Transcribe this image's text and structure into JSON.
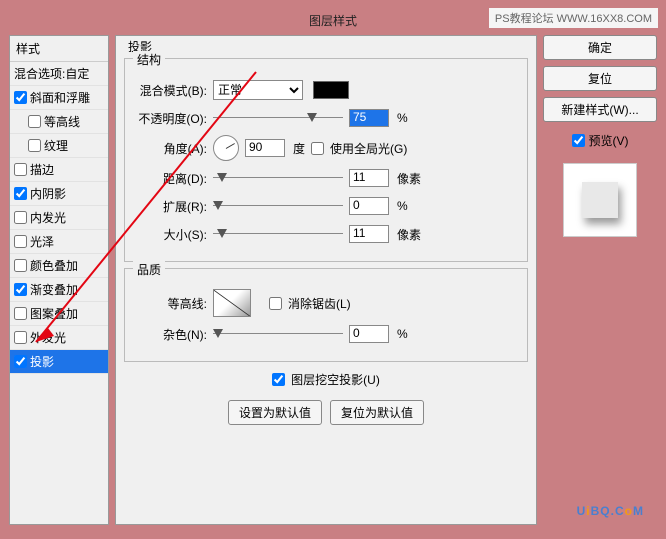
{
  "watermark_top": "PS教程论坛  WWW.16XX8.COM",
  "watermark_bot": [
    "U",
    "i",
    "B",
    "Q",
    ".",
    "C",
    "o",
    "M"
  ],
  "title": "图层样式",
  "sidebar": {
    "header": "样式",
    "blend": "混合选项:自定",
    "items": [
      {
        "label": "斜面和浮雕",
        "checked": true
      },
      {
        "label": "等高线",
        "checked": false,
        "sub": true
      },
      {
        "label": "纹理",
        "checked": false,
        "sub": true
      },
      {
        "label": "描边",
        "checked": false
      },
      {
        "label": "内阴影",
        "checked": true
      },
      {
        "label": "内发光",
        "checked": false
      },
      {
        "label": "光泽",
        "checked": false
      },
      {
        "label": "颜色叠加",
        "checked": false
      },
      {
        "label": "渐变叠加",
        "checked": true
      },
      {
        "label": "图案叠加",
        "checked": false
      },
      {
        "label": "外发光",
        "checked": false
      },
      {
        "label": "投影",
        "checked": true,
        "selected": true
      }
    ]
  },
  "panel": {
    "title": "投影",
    "structure": {
      "title": "结构",
      "blend_mode_label": "混合模式(B):",
      "blend_mode_value": "正常",
      "opacity_label": "不透明度(O):",
      "opacity_value": "75",
      "opacity_unit": "%",
      "angle_label": "角度(A):",
      "angle_value": "90",
      "angle_unit": "度",
      "global_light": "使用全局光(G)",
      "distance_label": "距离(D):",
      "distance_value": "11",
      "distance_unit": "像素",
      "spread_label": "扩展(R):",
      "spread_value": "0",
      "spread_unit": "%",
      "size_label": "大小(S):",
      "size_value": "11",
      "size_unit": "像素"
    },
    "quality": {
      "title": "品质",
      "contour_label": "等高线:",
      "antialias": "消除锯齿(L)",
      "noise_label": "杂色(N):",
      "noise_value": "0",
      "noise_unit": "%"
    },
    "knockout": "图层挖空投影(U)",
    "make_default": "设置为默认值",
    "reset_default": "复位为默认值"
  },
  "buttons": {
    "ok": "确定",
    "cancel": "复位",
    "new_style": "新建样式(W)...",
    "preview": "预览(V)"
  }
}
